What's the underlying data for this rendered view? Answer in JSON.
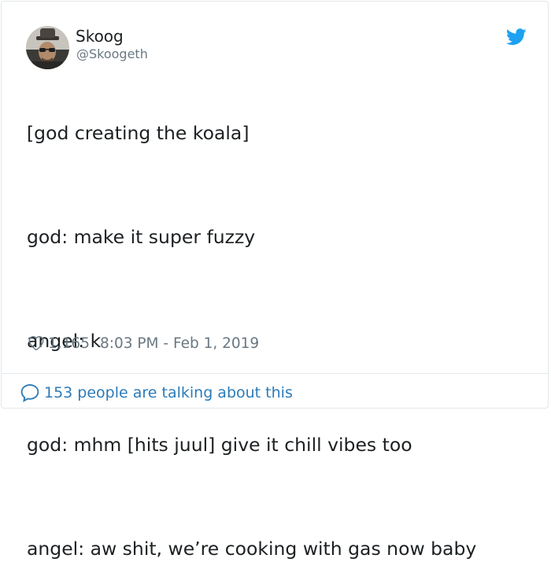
{
  "author": {
    "display_name": "Skoog",
    "handle": "@Skoogeth",
    "avatar_icon": "user-avatar-photo"
  },
  "brand": {
    "icon": "twitter-bird-icon",
    "color": "#1da1f2"
  },
  "tweet": {
    "lines": [
      "[god creating the koala]",
      "god: make it super fuzzy",
      "angel: k",
      "god: mhm [hits juul] give it chill vibes too",
      "angel: aw shit, we’re cooking with gas now baby"
    ]
  },
  "meta": {
    "like_icon": "heart-outline-icon",
    "like_count": "1,165",
    "timestamp": "8:03 PM - Feb 1, 2019"
  },
  "footer": {
    "comment_icon": "speech-bubble-icon",
    "discussion_text": "153 people are talking about this",
    "link_color": "#2b7bb9"
  }
}
